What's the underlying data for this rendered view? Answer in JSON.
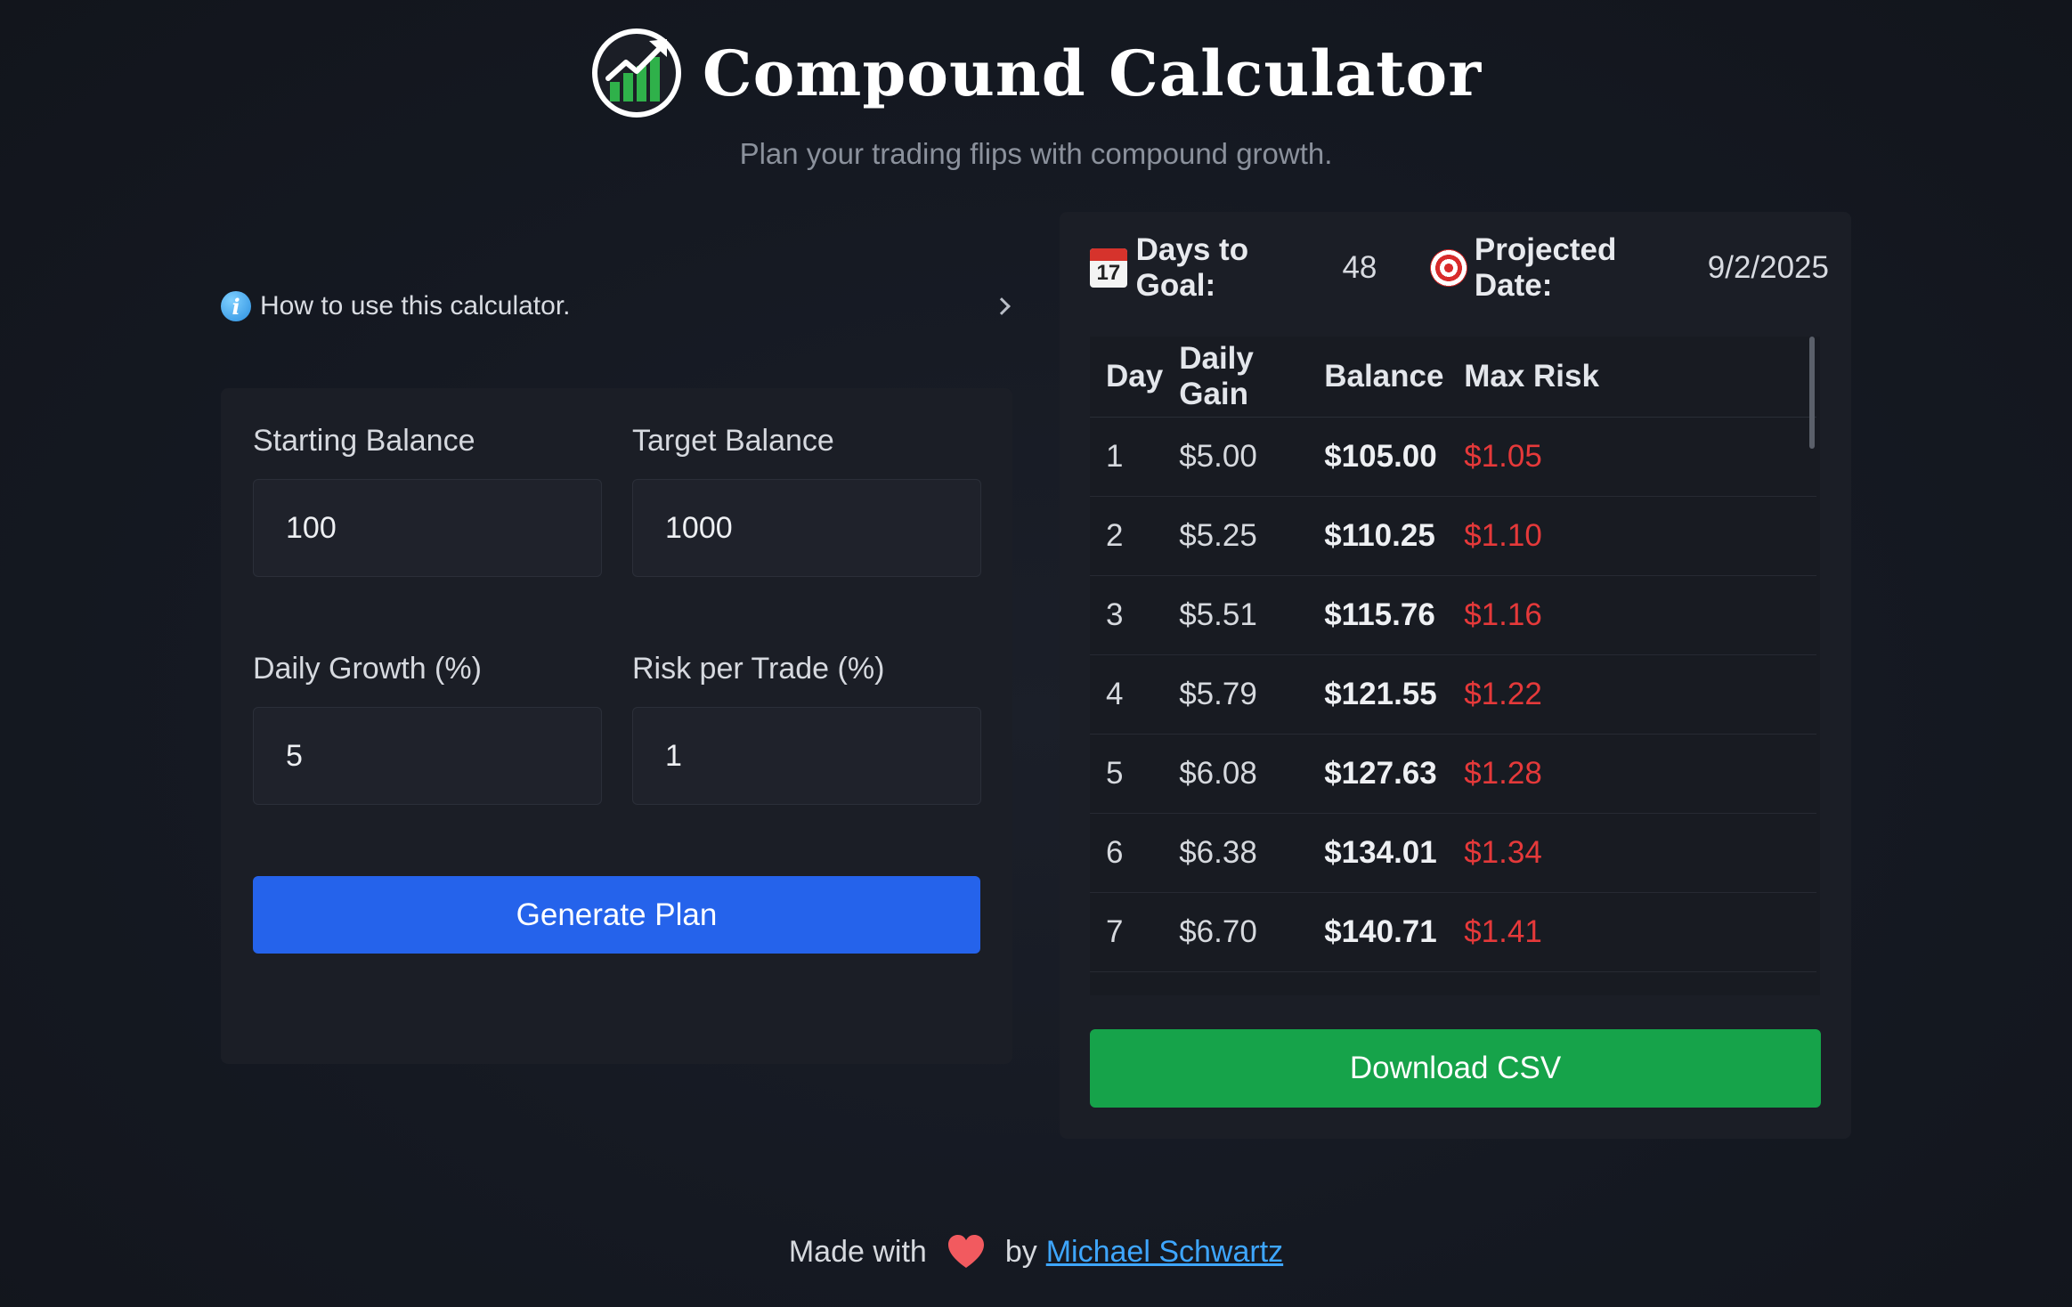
{
  "header": {
    "title": "Compound Calculator",
    "subtitle": "Plan your trading flips with compound growth.",
    "logo_icon": "chart-growth-logo-icon"
  },
  "howto": {
    "label": "How to use this calculator.",
    "icon": "info-icon"
  },
  "form": {
    "starting_balance": {
      "label": "Starting Balance",
      "value": "100"
    },
    "target_balance": {
      "label": "Target Balance",
      "value": "1000"
    },
    "daily_growth": {
      "label": "Daily Growth (%)",
      "value": "5"
    },
    "risk_per_trade": {
      "label": "Risk per Trade (%)",
      "value": "1"
    },
    "generate_label": "Generate Plan"
  },
  "results": {
    "days_label": "Days to Goal:",
    "days_value": "48",
    "date_label": "Projected Date:",
    "date_value": "9/2/2025",
    "calendar_icon_text": "17",
    "columns": [
      "Day",
      "Daily Gain",
      "Balance",
      "Max Risk"
    ],
    "rows": [
      [
        "1",
        "$5.00",
        "$105.00",
        "$1.05"
      ],
      [
        "2",
        "$5.25",
        "$110.25",
        "$1.10"
      ],
      [
        "3",
        "$5.51",
        "$115.76",
        "$1.16"
      ],
      [
        "4",
        "$5.79",
        "$121.55",
        "$1.22"
      ],
      [
        "5",
        "$6.08",
        "$127.63",
        "$1.28"
      ],
      [
        "6",
        "$6.38",
        "$134.01",
        "$1.34"
      ],
      [
        "7",
        "$6.70",
        "$140.71",
        "$1.41"
      ]
    ],
    "csv_label": "Download CSV"
  },
  "footer": {
    "made_with": "Made with",
    "by": "by",
    "author": "Michael Schwartz"
  },
  "colors": {
    "primary_button": "#2563eb",
    "csv_button": "#16a34a",
    "risk_text": "#e5393a",
    "link": "#3ea6ff"
  }
}
